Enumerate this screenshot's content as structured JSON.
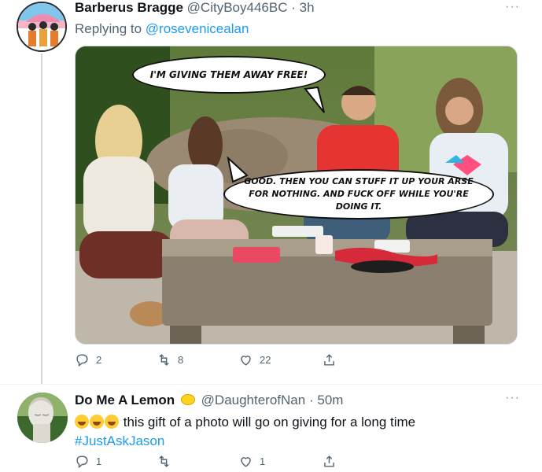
{
  "tweets": [
    {
      "name": "Barberus Bragge",
      "handle": "@CityBoy446BC",
      "separator": "·",
      "time": "3h",
      "more": "···",
      "replying_prefix": "Replying to",
      "replying_to": "@rosevenicealan",
      "image": {
        "bubble_top": "I'M GIVING THEM AWAY FREE!",
        "bubble_bottom": "GOOD. THEN YOU CAN STUFF IT UP YOUR ARSE FOR NOTHING. AND FUCK OFF WHILE YOU'RE DOING IT."
      },
      "stats": {
        "replies": "2",
        "retweets": "8",
        "likes": "22"
      }
    },
    {
      "name": "Do Me A Lemon",
      "handle": "@DaughterofNan",
      "separator": "·",
      "time": "50m",
      "more": "···",
      "text": "this gift of a photo will go on giving for a long time",
      "hashtag": "#JustAskJason",
      "stats": {
        "replies": "1",
        "retweets": "",
        "likes": "1"
      }
    }
  ],
  "colors": {
    "link": "#1d9bf0",
    "muted": "#536471",
    "name": "#0f1419"
  },
  "icons": [
    "reply-icon",
    "retweet-icon",
    "like-icon",
    "share-icon",
    "more-icon",
    "lemon-emoji",
    "laughing-emoji"
  ]
}
